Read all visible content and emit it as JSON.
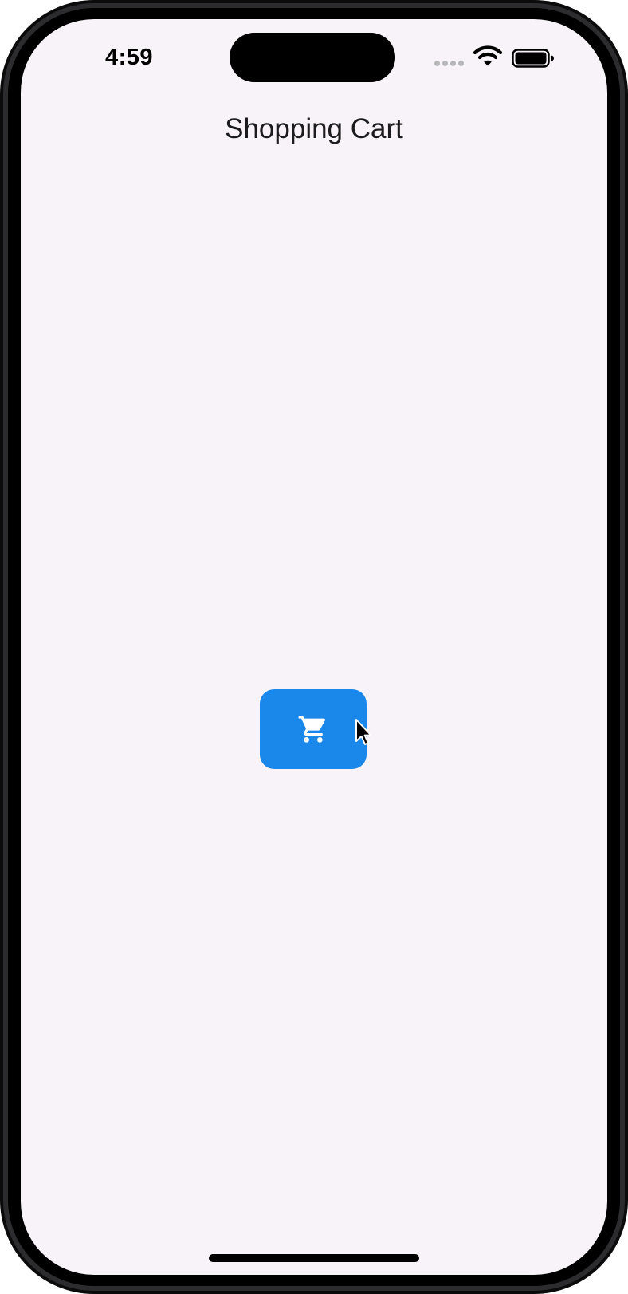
{
  "status_bar": {
    "time": "4:59",
    "icons": [
      "signal-icon",
      "wifi-icon",
      "battery-icon"
    ]
  },
  "nav": {
    "title": "Shopping Cart"
  },
  "cart_button": {
    "icon": "shopping-cart-icon",
    "color": "#1a88ea"
  },
  "colors": {
    "background": "#f8f3f8",
    "accent": "#1a88ea"
  }
}
